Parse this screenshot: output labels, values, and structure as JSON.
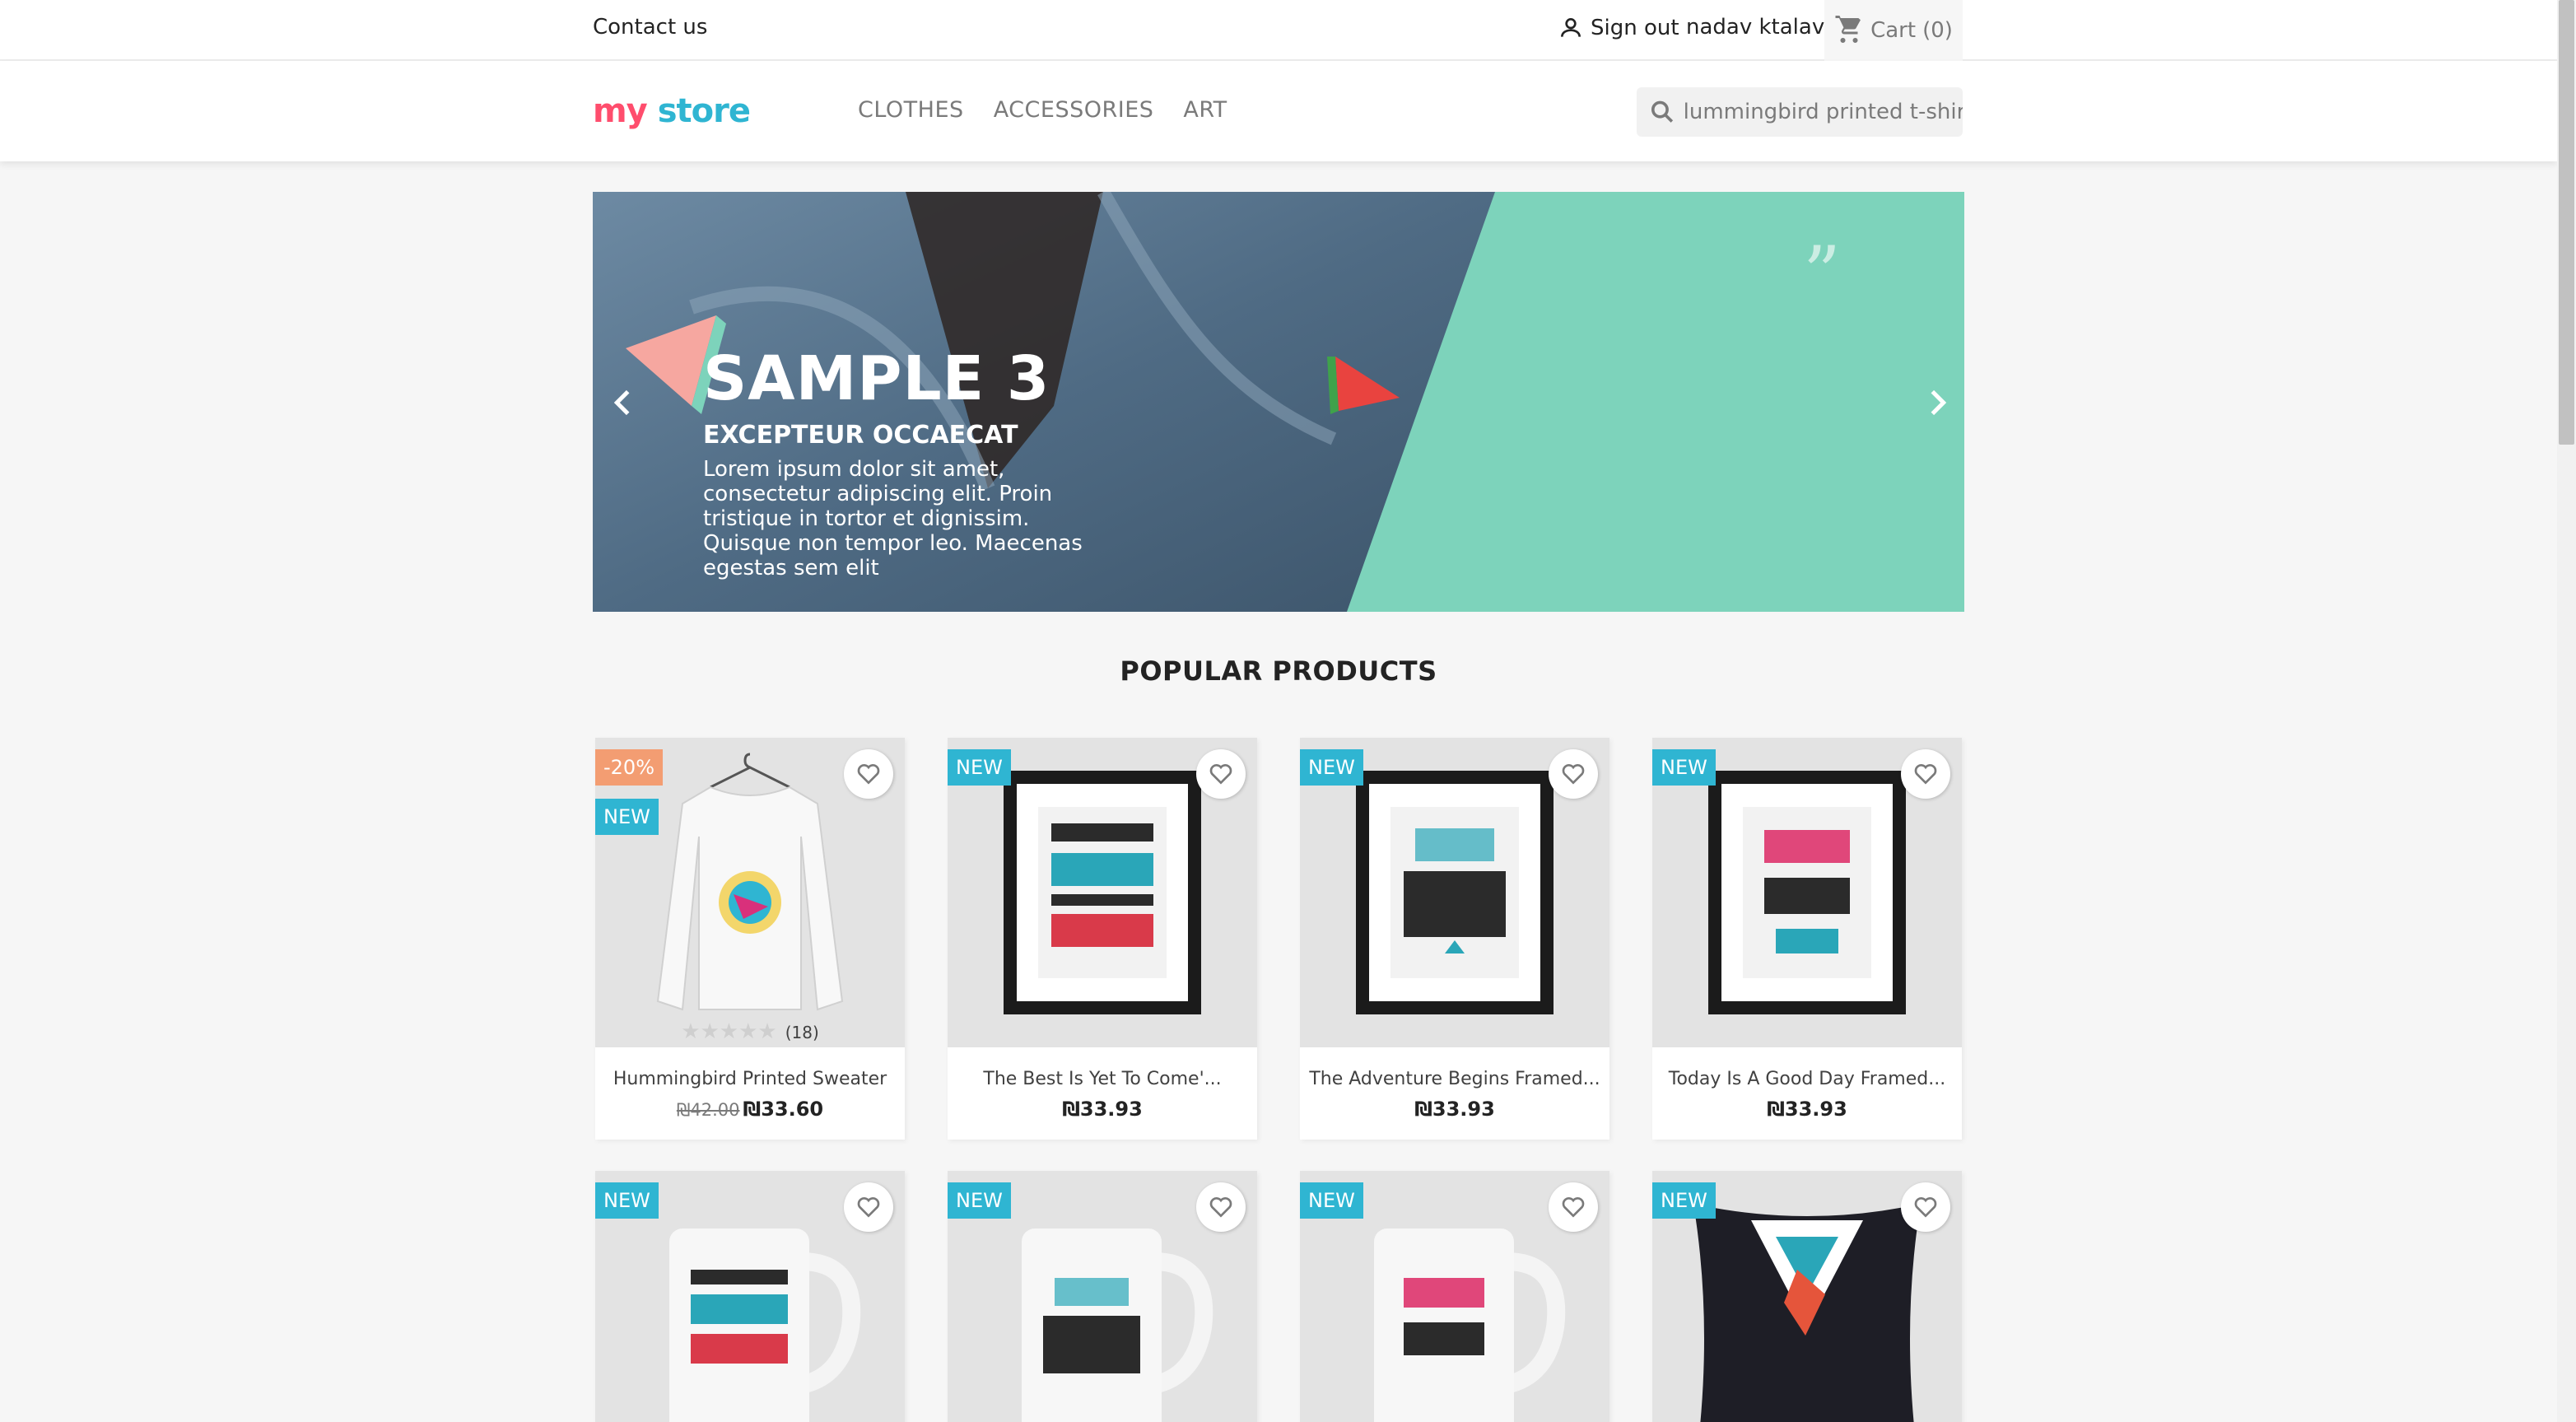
{
  "topbar": {
    "contact_label": "Contact us",
    "signout_label": "Sign out",
    "username": "nadav ktalav",
    "cart_label": "Cart",
    "cart_count": "(0)"
  },
  "header": {
    "logo_parts": [
      "my",
      " ",
      "store"
    ],
    "menu": [
      "CLOTHES",
      "ACCESSORIES",
      "ART"
    ],
    "search_value": "lummingbird printed t-shirt"
  },
  "banner": {
    "title": "SAMPLE 3",
    "subtitle": "EXCEPTEUR OCCAECAT",
    "description": "Lorem ipsum dolor sit amet, consectetur adipiscing elit. Proin tristique in tortor et dignissim. Quisque non tempor leo. Maecenas egestas sem elit"
  },
  "section_title": "POPULAR PRODUCTS",
  "products": [
    {
      "name": "Hummingbird Printed Sweater",
      "old_price": "₪42.00",
      "price": "₪33.60",
      "discount": "-20%",
      "flag": "NEW",
      "rating_count": "(18)",
      "stars": 5
    },
    {
      "name": "The Best Is Yet To Come'...",
      "price": "₪33.93",
      "flag": "NEW"
    },
    {
      "name": "The Adventure Begins Framed...",
      "price": "₪33.93",
      "flag": "NEW"
    },
    {
      "name": "Today Is A Good Day Framed...",
      "price": "₪33.93",
      "flag": "NEW"
    },
    {
      "flag": "NEW"
    },
    {
      "flag": "NEW"
    },
    {
      "flag": "NEW"
    },
    {
      "flag": "NEW"
    }
  ],
  "colors": {
    "accent": "#2fb5d2",
    "discount": "#f39d72",
    "banner_green": "#7dd3bb"
  }
}
